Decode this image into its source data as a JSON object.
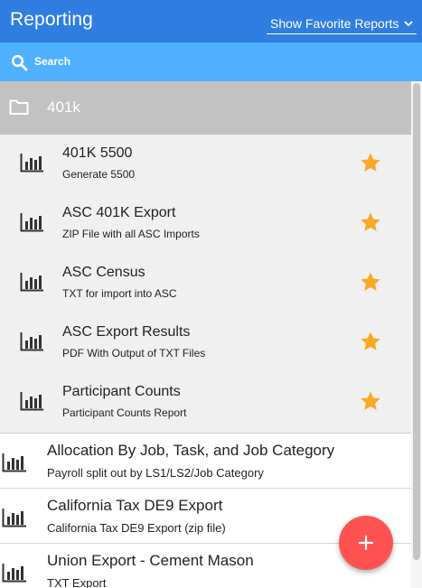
{
  "appbar": {
    "title": "Reporting",
    "filter_selected": "Show Favorite Reports"
  },
  "search": {
    "label": "Search"
  },
  "folder": {
    "name": "401k",
    "icon": "folder-icon"
  },
  "folder_items": [
    {
      "title": "401K 5500",
      "subtitle": "Generate 5500",
      "favorite": true
    },
    {
      "title": "ASC 401K Export",
      "subtitle": "ZIP File with all ASC Imports",
      "favorite": true
    },
    {
      "title": "ASC Census",
      "subtitle": "TXT for import into ASC",
      "favorite": true
    },
    {
      "title": "ASC Export Results",
      "subtitle": "PDF With Output of TXT Files",
      "favorite": true
    },
    {
      "title": "Participant Counts",
      "subtitle": "Participant Counts Report",
      "favorite": true
    }
  ],
  "reports": [
    {
      "title": "Allocation By Job, Task, and Job Category",
      "subtitle": "Payroll split out by LS1/LS2/Job Category"
    },
    {
      "title": "California Tax DE9 Export",
      "subtitle": "California Tax DE9 Export (zip file)"
    },
    {
      "title": "Union Export - Cement Mason",
      "subtitle": "TXT Export"
    }
  ],
  "colors": {
    "appbar": "#2f7de1",
    "searchbar": "#4fb0ff",
    "folder": "#c2c2c2",
    "star": "#f9a825",
    "fab": "#ff5252"
  },
  "icons": {
    "report": "bar-chart-icon",
    "favorite": "star-icon",
    "search": "search-icon",
    "add": "plus-icon"
  }
}
